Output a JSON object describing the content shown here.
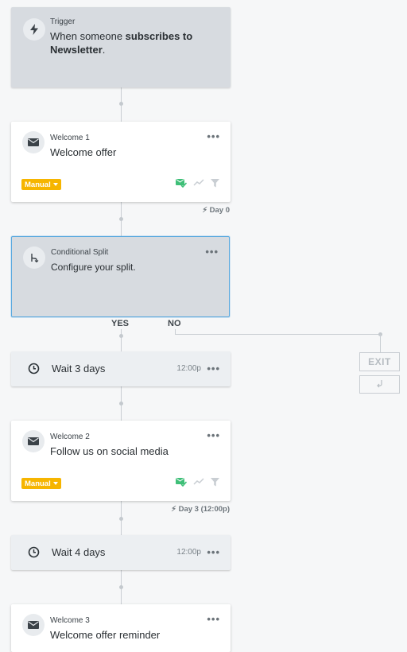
{
  "trigger": {
    "label": "Trigger",
    "text_prefix": "When someone ",
    "text_bold1": "subscribes to",
    "text_bold2": "Newsletter",
    "text_suffix": "."
  },
  "steps": {
    "welcome1": {
      "label": "Welcome 1",
      "title": "Welcome offer",
      "badge": "Manual",
      "timing": "Day 0"
    },
    "split": {
      "label": "Conditional Split",
      "title": "Configure your split.",
      "yes": "YES",
      "no": "NO"
    },
    "wait1": {
      "title": "Wait 3 days",
      "time": "12:00p"
    },
    "welcome2": {
      "label": "Welcome 2",
      "title": "Follow us on social media",
      "badge": "Manual",
      "timing": "Day 3 (12:00p)"
    },
    "wait2": {
      "title": "Wait 4 days",
      "time": "12:00p"
    },
    "welcome3": {
      "label": "Welcome 3",
      "title": "Welcome offer reminder"
    }
  },
  "exit_branch": {
    "exit_label": "EXIT"
  },
  "menu_glyph": "•••",
  "colors": {
    "badge": "#f6b500",
    "split_border": "#5aa9df",
    "check": "#3fbf78"
  }
}
